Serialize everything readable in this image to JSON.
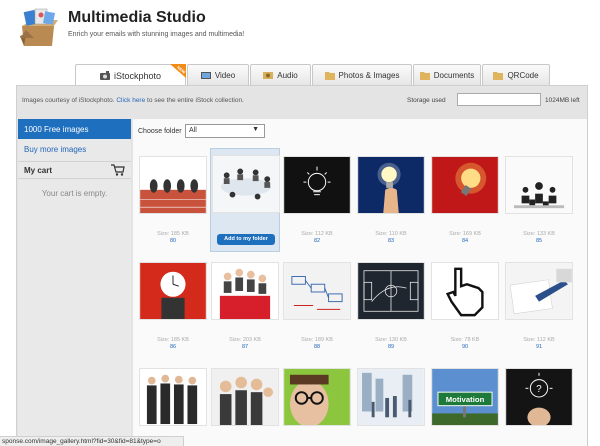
{
  "app": {
    "title": "Multimedia Studio",
    "subtitle": "Enrich your emails with stunning images and multimedia!"
  },
  "tabs": [
    {
      "label": "iStockphoto",
      "icon": "istock-camera-icon",
      "badge": "NEW",
      "active": true
    },
    {
      "label": "Video",
      "icon": "video-icon"
    },
    {
      "label": "Audio",
      "icon": "audio-icon"
    },
    {
      "label": "Photos & Images",
      "icon": "photos-folder-icon"
    },
    {
      "label": "Documents",
      "icon": "documents-folder-icon"
    },
    {
      "label": "QRCode",
      "icon": "qrcode-folder-icon"
    }
  ],
  "info": {
    "credit_prefix": "Images courtesy of iStockphoto.",
    "credit_link": "Click here",
    "credit_suffix": "to see the entire iStock collection.",
    "storage_label": "Storage used",
    "storage_left": "1024MB left"
  },
  "sidebar": {
    "active_item": "1000 Free images",
    "link_item": "Buy more images",
    "cart_heading": "My cart",
    "cart_empty": "Your cart is empty."
  },
  "folder": {
    "label": "Choose folder",
    "selected": "All"
  },
  "add_button_label": "Add to my folder",
  "images": [
    {
      "size": "Size: 185 KB",
      "id": "80",
      "subject": "business-race"
    },
    {
      "size": "",
      "id": "",
      "subject": "team-meeting",
      "hovered": true
    },
    {
      "size": "Size: 112 KB",
      "id": "82",
      "subject": "chalk-bulb"
    },
    {
      "size": "Size: 110 KB",
      "id": "83",
      "subject": "hand-bulb"
    },
    {
      "size": "Size: 169 KB",
      "id": "84",
      "subject": "red-bulb"
    },
    {
      "size": "Size: 133 KB",
      "id": "85",
      "subject": "chess"
    },
    {
      "size": "Size: 185 KB",
      "id": "86",
      "subject": "clock-head"
    },
    {
      "size": "Size: 203 KB",
      "id": "87",
      "subject": "red-team"
    },
    {
      "size": "Size: 189 KB",
      "id": "88",
      "subject": "strategy"
    },
    {
      "size": "Size: 130 KB",
      "id": "89",
      "subject": "chalk-play"
    },
    {
      "size": "Size: 78 KB",
      "id": "90",
      "subject": "cursor-hand"
    },
    {
      "size": "Size: 112 KB",
      "id": "91",
      "subject": "writing"
    },
    {
      "size": "",
      "id": "",
      "subject": "business-people"
    },
    {
      "size": "",
      "id": "",
      "subject": "happy-team"
    },
    {
      "size": "",
      "id": "",
      "subject": "glasses-man"
    },
    {
      "size": "",
      "id": "",
      "subject": "city-crowd"
    },
    {
      "size": "",
      "id": "",
      "subject": "motivation-sign",
      "sign_text": "Motivation"
    },
    {
      "size": "",
      "id": "",
      "subject": "question-bulb"
    }
  ],
  "status_url": "sponse.com/image_gallery.html?fid=30&fid=81&type=o",
  "colors": {
    "accent": "#1f6fbf",
    "link": "#2266bb",
    "frame": "#e4e4e4"
  }
}
